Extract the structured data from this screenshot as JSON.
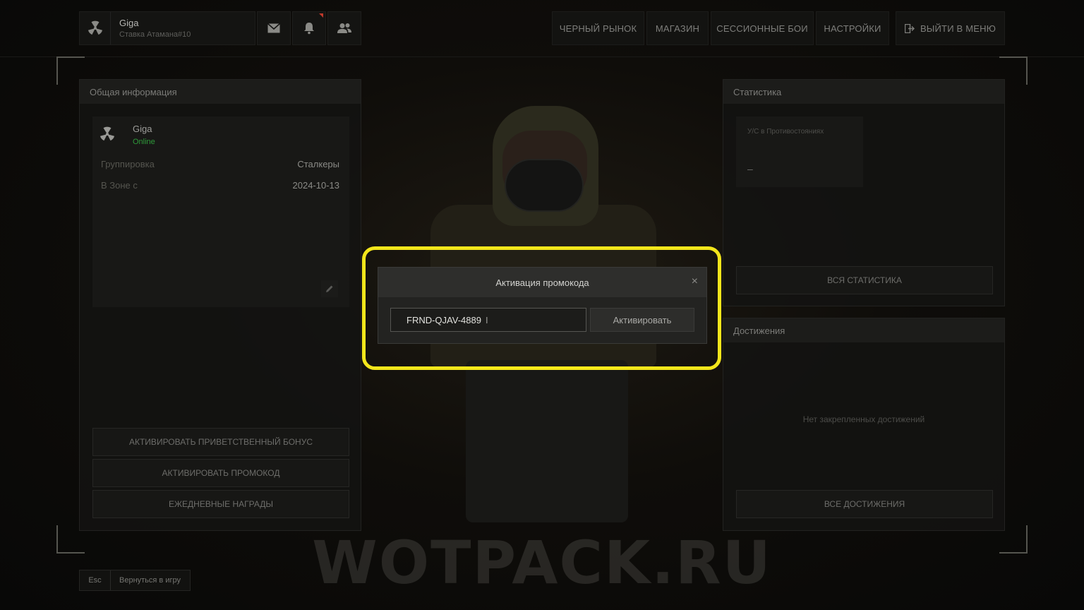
{
  "profile": {
    "name": "Giga",
    "subtitle": "Ставка Атамана#10"
  },
  "nav": {
    "black_market": "ЧЕРНЫЙ РЫНОК",
    "shop": "МАГАЗИН",
    "session_battles": "СЕССИОННЫЕ БОИ",
    "settings": "НАСТРОЙКИ",
    "exit_to_menu": "ВЫЙТИ В МЕНЮ"
  },
  "general_info": {
    "title": "Общая информация",
    "player_name": "Giga",
    "status": "Online",
    "faction_label": "Группировка",
    "faction_value": "Сталкеры",
    "zone_since_label": "В Зоне с",
    "zone_since_value": "2024-10-13",
    "buttons": {
      "welcome_bonus": "АКТИВИРОВАТЬ ПРИВЕТСТВЕННЫЙ БОНУС",
      "activate_promo": "АКТИВИРОВАТЬ ПРОМОКОД",
      "daily_rewards": "ЕЖЕДНЕВНЫЕ НАГРАДЫ"
    }
  },
  "statistics": {
    "title": "Статистика",
    "card_label": "У/С в Противостояниях",
    "card_value": "–",
    "all_stats": "ВСЯ СТАТИСТИКА"
  },
  "achievements": {
    "title": "Достижения",
    "empty_text": "Нет закрепленных достижений",
    "all_achievements": "ВСЕ ДОСТИЖЕНИЯ"
  },
  "promo_modal": {
    "title": "Активация промокода",
    "close": "×",
    "input_value": "FRND-QJAV-4889",
    "activate": "Активировать"
  },
  "watermark": "WOTPACK.RU",
  "footer": {
    "key": "Esc",
    "label": "Вернуться в игру"
  },
  "colors": {
    "highlight": "#f3e61b",
    "online": "#2e9a3a",
    "notification": "#c0392b"
  }
}
